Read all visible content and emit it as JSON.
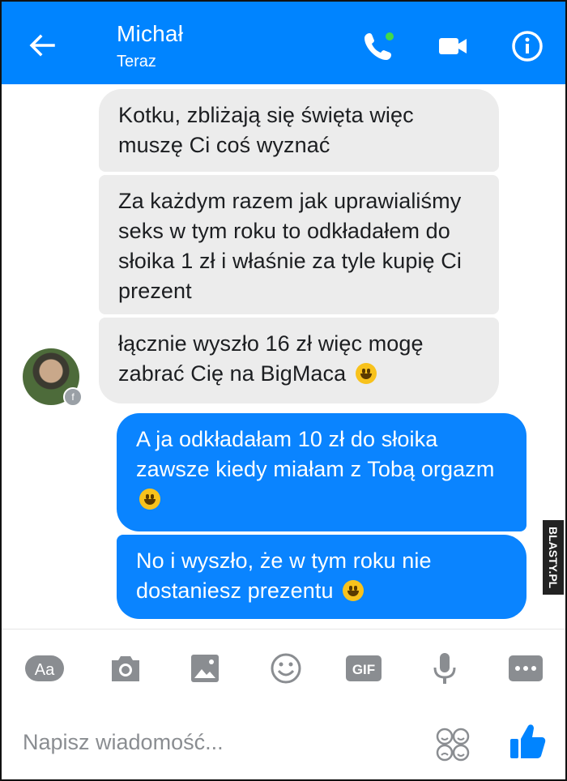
{
  "header": {
    "contact_name": "Michał",
    "status": "Teraz"
  },
  "messages": [
    {
      "side": "incoming",
      "text": "Kotku, zbliżają się święta więc muszę Ci coś wyznać"
    },
    {
      "side": "incoming",
      "text": "Za każdym razem jak uprawialiśmy seks w tym roku to odkładałem do słoika 1 zł i właśnie za tyle kupię Ci prezent"
    },
    {
      "side": "incoming",
      "text": "łącznie wyszło 16 zł więc mogę zabrać Cię na BigMaca",
      "emoji": "smile"
    },
    {
      "side": "outgoing",
      "text": "A ja odkładałam 10 zł do słoika zawsze kiedy miałam z Tobą orgazm",
      "emoji": "smile"
    },
    {
      "side": "outgoing",
      "text": "No i wyszło, że w tym roku nie dostaniesz prezentu",
      "emoji": "smile"
    }
  ],
  "toolbar": {
    "aa_label": "Aa",
    "gif_label": "GIF",
    "icons": [
      "text-format-icon",
      "camera-icon",
      "image-icon",
      "emoji-icon",
      "gif-icon",
      "microphone-icon",
      "more-icon"
    ]
  },
  "composer": {
    "placeholder": "Napisz wiadomość..."
  },
  "watermark": "BLASTY.PL",
  "colors": {
    "accent": "#0084ff",
    "incoming_bubble": "#ececec",
    "outgoing_bubble": "#0a84ff"
  }
}
